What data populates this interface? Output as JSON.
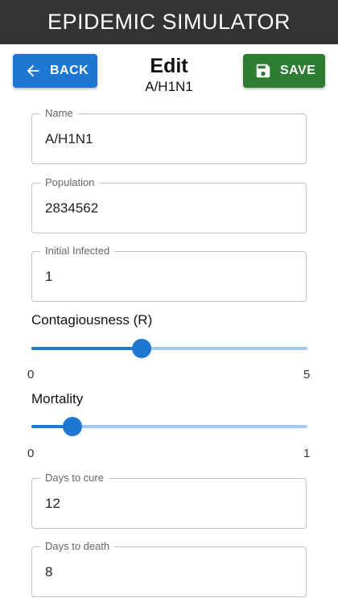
{
  "app": {
    "title": "EPIDEMIC SIMULATOR"
  },
  "header": {
    "back_label": "BACK",
    "save_label": "SAVE",
    "title": "Edit",
    "subtitle": "A/H1N1"
  },
  "fields": {
    "name": {
      "label": "Name",
      "value": "A/H1N1"
    },
    "population": {
      "label": "Population",
      "value": "2834562"
    },
    "initial_infected": {
      "label": "Initial Infected",
      "value": "1"
    },
    "days_to_cure": {
      "label": "Days to cure",
      "value": "12"
    },
    "days_to_death": {
      "label": "Days to death",
      "value": "8"
    }
  },
  "sliders": {
    "contagiousness": {
      "label": "Contagiousness (R)",
      "min": "0",
      "max": "5",
      "value": 2
    },
    "mortality": {
      "label": "Mortality",
      "min": "0",
      "max": "1",
      "value": 0.15
    }
  },
  "colors": {
    "app_bar": "#333333",
    "primary": "#1e77d3",
    "save": "#2f7d32",
    "rail": "#a8c9ee"
  }
}
